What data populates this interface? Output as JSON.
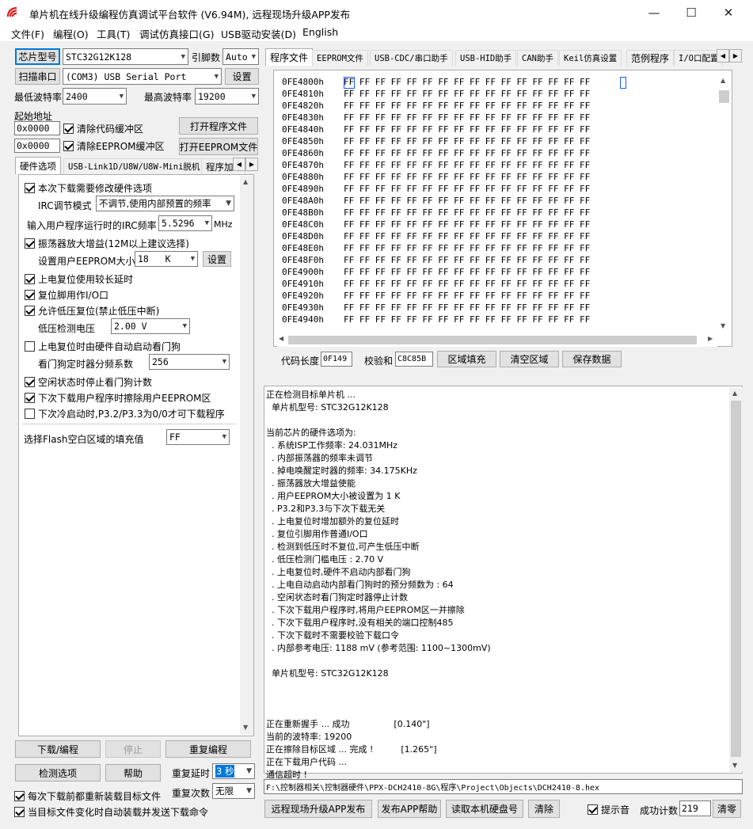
{
  "window": {
    "title": "单片机在线升级编程仿真调试平台软件 (V6.94M), 远程现场升级APP发布",
    "minimize": "—",
    "maximize": "☐",
    "close": "✕"
  },
  "menu": [
    "文件(F)",
    "编程(O)",
    "工具(T)",
    "调试仿真接口(G)",
    "USB驱动安装(D)",
    "English"
  ],
  "left": {
    "chip_button": "芯片型号",
    "chip_value": "STC32G12K128",
    "pins_label": "引脚数",
    "pins_value": "Auto",
    "scan_button": "扫描串口",
    "port_value": "(COM3) USB Serial Port",
    "settings_button": "设置",
    "min_baud_label": "最低波特率",
    "min_baud_value": "2400",
    "max_baud_label": "最高波特率",
    "max_baud_value": "19200",
    "start_addr_label": "起始地址",
    "addr1": "0x0000",
    "clear_code_label": "清除代码缓冲区",
    "open_prog_button": "打开程序文件",
    "addr2": "0x0000",
    "clear_eeprom_label": "清除EEPROM缓冲区",
    "open_eeprom_button": "打开EEPROM文件",
    "tabs": [
      "硬件选项",
      "USB-Link1D/U8W/U8W-Mini脱机",
      "程序加"
    ],
    "hw": {
      "modify_hw": "本次下载需要修改硬件选项",
      "irc_mode_label": "IRC调节模式",
      "irc_mode_value": "不调节,使用内部预置的频率",
      "irc_freq_label": "输入用户程序运行时的IRC频率",
      "irc_freq_value": "5.5296",
      "irc_freq_unit": "MHz",
      "osc_gain": "振荡器放大增益(12M以上建议选择)",
      "eeprom_size_label": "设置用户EEPROM大小",
      "eeprom_size_value": "18   K",
      "eeprom_set_button": "设置",
      "long_delay": "上电复位使用较长延时",
      "reset_io": "复位脚用作I/O口",
      "lvr": "允许低压复位(禁止低压中断)",
      "lvd_label": "低压检测电压",
      "lvd_value": "2.00 V",
      "wdt_auto": "上电复位时由硬件自动启动看门狗",
      "wdt_div_label": "看门狗定时器分频系数",
      "wdt_div_value": "256",
      "idle_wdt": "空闲状态时停止看门狗计数",
      "erase_eeprom": "下次下载用户程序时擦除用户EEPROM区",
      "p32_p33": "下次冷启动时,P3.2/P3.3为0/0才可下载程序",
      "fill_label": "选择Flash空白区域的填充值",
      "fill_value": "FF"
    },
    "download_button": "下载/编程",
    "stop_button": "停止",
    "reprogram_button": "重复编程",
    "check_button": "检测选项",
    "help_button": "帮助",
    "repeat_delay_label": "重复延时",
    "repeat_delay_value": "3 秒",
    "repeat_count_label": "重复次数",
    "repeat_count_value": "无限",
    "reload_label": "每次下载前都重新装载目标文件",
    "autoload_label": "当目标文件变化时自动装载并发送下载命令"
  },
  "right": {
    "tabs": [
      "程序文件",
      "EEPROM文件",
      "USB-CDC/串口助手",
      "USB-HID助手",
      "CAN助手",
      "Keil仿真设置",
      "范例程序",
      "I/O口配置"
    ],
    "hex_start": "0FE4800h",
    "hex_rows": [
      "0FE4800h",
      "0FE4810h",
      "0FE4820h",
      "0FE4830h",
      "0FE4840h",
      "0FE4850h",
      "0FE4860h",
      "0FE4870h",
      "0FE4880h",
      "0FE4890h",
      "0FE48A0h",
      "0FE48B0h",
      "0FE48C0h",
      "0FE48D0h",
      "0FE48E0h",
      "0FE48F0h",
      "0FE4900h",
      "0FE4910h",
      "0FE4920h",
      "0FE4930h",
      "0FE4940h"
    ],
    "hex_bytes": "FF FF FF FF FF FF FF FF FF FF FF FF FF FF FF FF",
    "code_len_label": "代码长度",
    "code_len_value": "0F149",
    "checksum_label": "校验和",
    "checksum_value": "C8C85B",
    "fill_button": "区域填充",
    "clear_area_button": "清空区域",
    "save_button": "保存数据",
    "log": [
      "正在检测目标单片机 ...",
      "  单片机型号: STC32G12K128",
      "",
      "当前芯片的硬件选项为:",
      "  . 系统ISP工作频率: 24.031MHz",
      "  . 内部振荡器的频率未调节",
      "  . 掉电唤醒定时器的频率: 34.175KHz",
      "  . 振荡器放大增益使能",
      "  . 用户EEPROM大小被设置为 1 K",
      "  . P3.2和P3.3与下次下载无关",
      "  . 上电复位时增加额外的复位延时",
      "  . 复位引脚用作普通I/O口",
      "  . 检测到低压时不复位,可产生低压中断",
      "  . 低压检测门槛电压 : 2.70 V",
      "  . 上电复位时,硬件不启动内部看门狗",
      "  . 上电自动启动内部看门狗时的预分频数为 : 64",
      "  . 空闲状态时看门狗定时器停止计数",
      "  . 下次下载用户程序时,将用户EEPROM区一并擦除",
      "  . 下次下载用户程序时,没有相关的端口控制485",
      "  . 下次下载时不需要校验下载口令",
      "  . 内部参考电压: 1188 mV (参考范围: 1100~1300mV)",
      "",
      "  单片机型号: STC32G12K128",
      "",
      "",
      "",
      "正在重新握手 ... 成功                [0.140\"]",
      "当前的波特率: 19200",
      "正在擦除目标区域 ... 完成 !          [1.265\"]",
      "正在下载用户代码 ...",
      "通信超时 !"
    ],
    "filepath": "F:\\控制器相关\\控制器硬件\\PPX-DCH2410-8G\\程序\\Project\\Objects\\DCH2410-8.hex",
    "remote_app_button": "远程现场升级APP发布",
    "app_help_button": "发布APP帮助",
    "read_disk_button": "读取本机硬盘号",
    "clear_button": "清除",
    "beep_label": "提示音",
    "success_label": "成功计数",
    "success_value": "219",
    "reset_count_button": "清零"
  }
}
